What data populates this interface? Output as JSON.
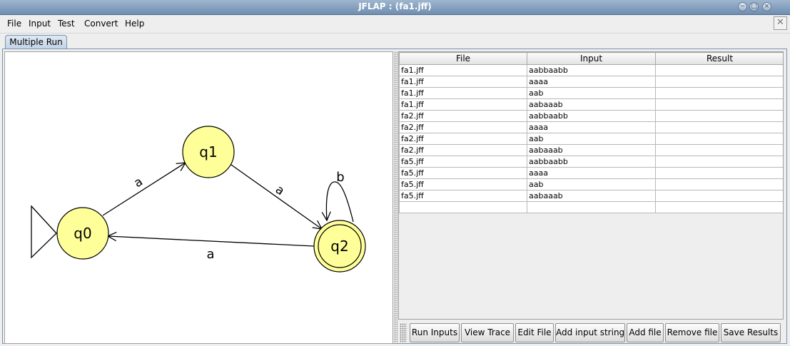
{
  "window": {
    "title": "JFLAP : (fa1.jff)",
    "minimize": "−",
    "maximize": "□",
    "close": "×"
  },
  "menubar": {
    "items": [
      "File",
      "Input",
      "Test",
      "Convert",
      "Help"
    ],
    "close_glyph": "✕"
  },
  "tabs": [
    {
      "label": "Multiple Run",
      "active": true
    }
  ],
  "automaton": {
    "states": [
      {
        "name": "q0",
        "initial": true,
        "final": false
      },
      {
        "name": "q1",
        "initial": false,
        "final": false
      },
      {
        "name": "q2",
        "initial": false,
        "final": true
      }
    ],
    "transitions": [
      {
        "from": "q0",
        "to": "q1",
        "label": "a"
      },
      {
        "from": "q1",
        "to": "q2",
        "label": "a"
      },
      {
        "from": "q2",
        "to": "q2",
        "label": "b"
      },
      {
        "from": "q2",
        "to": "q0",
        "label": "a"
      }
    ],
    "state_color": "#ffff99"
  },
  "table": {
    "headers": [
      "File",
      "Input",
      "Result"
    ],
    "rows": [
      [
        "fa1.jff",
        "aabbaabb",
        ""
      ],
      [
        "fa1.jff",
        "aaaa",
        ""
      ],
      [
        "fa1.jff",
        "aab",
        ""
      ],
      [
        "fa1.jff",
        "aabaaab",
        ""
      ],
      [
        "fa2.jff",
        "aabbaabb",
        ""
      ],
      [
        "fa2.jff",
        "aaaa",
        ""
      ],
      [
        "fa2.jff",
        "aab",
        ""
      ],
      [
        "fa2.jff",
        "aabaaab",
        ""
      ],
      [
        "fa5.jff",
        "aabbaabb",
        ""
      ],
      [
        "fa5.jff",
        "aaaa",
        ""
      ],
      [
        "fa5.jff",
        "aab",
        ""
      ],
      [
        "fa5.jff",
        "aabaaab",
        ""
      ],
      [
        "",
        "",
        ""
      ]
    ]
  },
  "buttons": {
    "run_inputs": "Run Inputs",
    "view_trace": "View Trace",
    "edit_file": "Edit File",
    "add_input_string": "Add input string",
    "add_file": "Add file",
    "remove_file": "Remove file",
    "save_results": "Save Results"
  }
}
